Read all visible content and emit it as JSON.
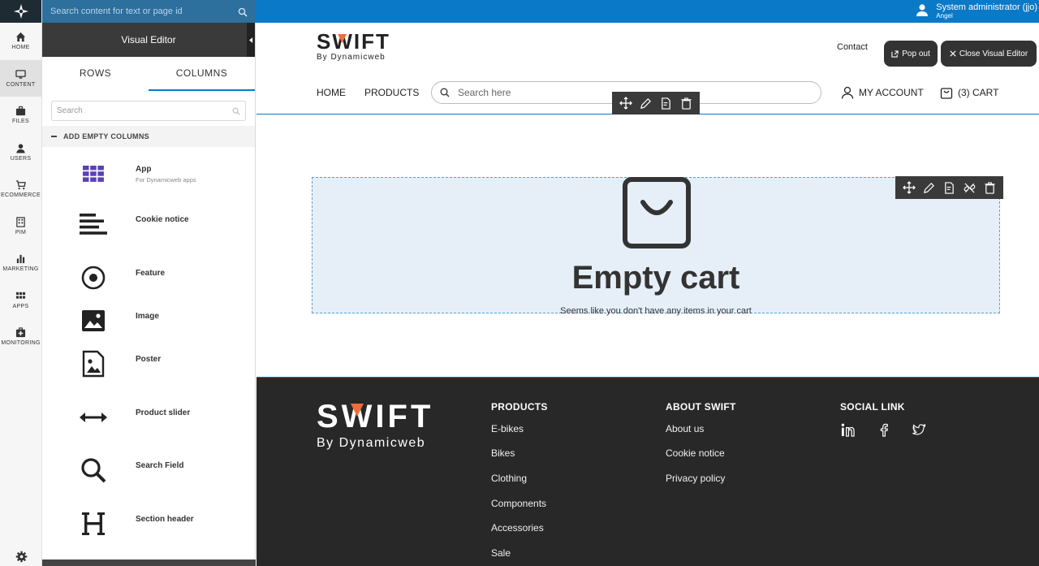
{
  "topbar": {
    "search_placeholder": "Search content for text or page id",
    "user_name": "System administrator (jjo)",
    "user_role": "Angel"
  },
  "nav": {
    "items": [
      {
        "label": "HOME",
        "icon": "home-icon"
      },
      {
        "label": "CONTENT",
        "icon": "monitor-icon"
      },
      {
        "label": "FILES",
        "icon": "briefcase-icon"
      },
      {
        "label": "USERS",
        "icon": "user-icon"
      },
      {
        "label": "ECOMMERCE",
        "icon": "cart-icon"
      },
      {
        "label": "PIM",
        "icon": "building-icon"
      },
      {
        "label": "MARKETING",
        "icon": "bar-chart-icon"
      },
      {
        "label": "APPS",
        "icon": "grid-icon"
      },
      {
        "label": "MONITORING",
        "icon": "medkit-icon"
      }
    ],
    "active": "CONTENT"
  },
  "editor": {
    "title": "Visual Editor",
    "tabs": [
      "ROWS",
      "COLUMNS"
    ],
    "active_tab": "COLUMNS",
    "search_placeholder": "Search",
    "section_title": "ADD EMPTY COLUMNS",
    "items": [
      {
        "label": "App",
        "sub": "For Dynamicweb apps",
        "icon": "app-grid-icon"
      },
      {
        "label": "Cookie notice",
        "sub": "",
        "icon": "text-lines-icon"
      },
      {
        "label": "Feature",
        "sub": "",
        "icon": "target-icon"
      },
      {
        "label": "Image",
        "sub": "",
        "icon": "image-icon"
      },
      {
        "label": "Poster",
        "sub": "",
        "icon": "poster-icon"
      },
      {
        "label": "Product slider",
        "sub": "",
        "icon": "arrows-horizontal-icon"
      },
      {
        "label": "Search Field",
        "sub": "",
        "icon": "search-icon"
      },
      {
        "label": "Section header",
        "sub": "",
        "icon": "heading-icon"
      }
    ]
  },
  "site": {
    "brand_main": "SWIFT",
    "brand_sub": "By Dynamicweb",
    "contact": "Contact",
    "pop_out": "Pop out",
    "close_editor": "Close Visual Editor",
    "nav": [
      "HOME",
      "PRODUCTS"
    ],
    "search_placeholder": "Search here",
    "account": "MY ACCOUNT",
    "cart": "(3) CART",
    "empty_title": "Empty cart",
    "empty_sub": "Seems like you don't have any items in your cart"
  },
  "footer": {
    "brand_main": "SWIFT",
    "brand_sub": "By Dynamicweb",
    "products_title": "PRODUCTS",
    "products": [
      "E-bikes",
      "Bikes",
      "Clothing",
      "Components",
      "Accessories",
      "Sale"
    ],
    "about_title": "ABOUT SWIFT",
    "about": [
      "About us",
      "Cookie notice",
      "Privacy policy"
    ],
    "social_title": "SOCIAL LINK",
    "social": [
      "linkedin-icon",
      "facebook-icon",
      "twitter-icon"
    ]
  },
  "colors": {
    "topbar": "#0a79c7",
    "accent": "#f26b3a",
    "toolbar": "#3a3a3a",
    "footer": "#282828",
    "app_icon": "#5b3fb5"
  }
}
